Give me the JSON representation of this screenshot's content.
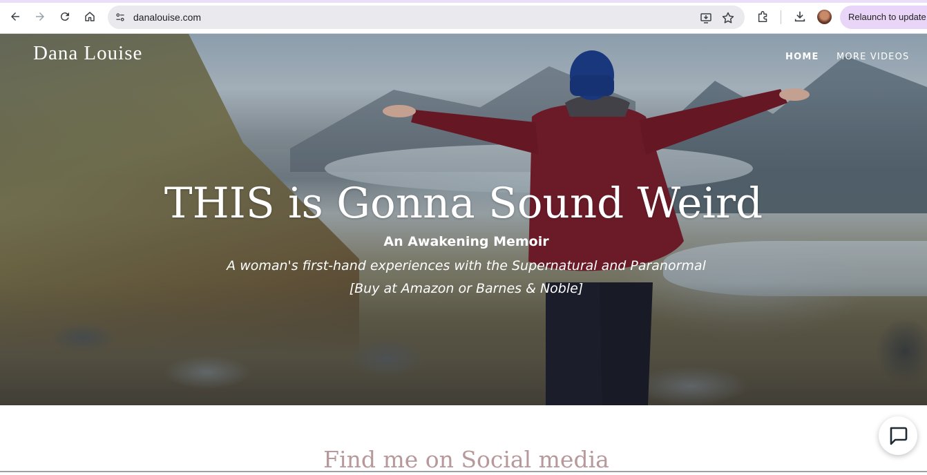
{
  "browser": {
    "url": "danalouise.com",
    "relaunch_label": "Relaunch to update",
    "icons": [
      "back-icon",
      "forward-icon",
      "reload-icon",
      "home-icon",
      "site-info-icon",
      "install-app-icon",
      "bookmark-star-icon",
      "extensions-icon",
      "downloads-icon",
      "profile-avatar"
    ]
  },
  "site": {
    "title": "Dana Louise",
    "nav": {
      "home": "HOME",
      "more_videos": "MORE VIDEOS"
    }
  },
  "hero": {
    "headline": "THIS is Gonna Sound Weird",
    "subtitle": "An Awakening Memoir",
    "tagline": "A woman's first-hand experiences with the Supernatural and Paranormal",
    "buy_line": "[Buy at Amazon or Barnes & Noble]"
  },
  "social": {
    "heading": "Find me on Social media"
  },
  "colors": {
    "accent_relaunch": "#e8d5f7",
    "social_heading": "#b7989b",
    "jacket": "#7a1f2e",
    "beanie": "#1d3f8f"
  }
}
